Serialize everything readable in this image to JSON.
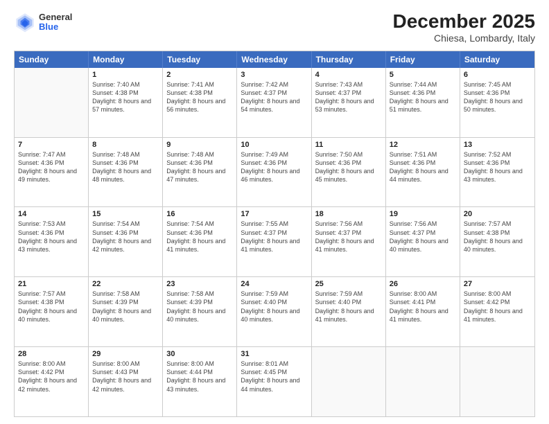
{
  "logo": {
    "general": "General",
    "blue": "Blue"
  },
  "title": "December 2025",
  "subtitle": "Chiesa, Lombardy, Italy",
  "days": [
    "Sunday",
    "Monday",
    "Tuesday",
    "Wednesday",
    "Thursday",
    "Friday",
    "Saturday"
  ],
  "weeks": [
    [
      {
        "day": "",
        "empty": true
      },
      {
        "day": "1",
        "sunrise": "7:40 AM",
        "sunset": "4:38 PM",
        "daylight": "8 hours and 57 minutes."
      },
      {
        "day": "2",
        "sunrise": "7:41 AM",
        "sunset": "4:38 PM",
        "daylight": "8 hours and 56 minutes."
      },
      {
        "day": "3",
        "sunrise": "7:42 AM",
        "sunset": "4:37 PM",
        "daylight": "8 hours and 54 minutes."
      },
      {
        "day": "4",
        "sunrise": "7:43 AM",
        "sunset": "4:37 PM",
        "daylight": "8 hours and 53 minutes."
      },
      {
        "day": "5",
        "sunrise": "7:44 AM",
        "sunset": "4:36 PM",
        "daylight": "8 hours and 51 minutes."
      },
      {
        "day": "6",
        "sunrise": "7:45 AM",
        "sunset": "4:36 PM",
        "daylight": "8 hours and 50 minutes."
      }
    ],
    [
      {
        "day": "7",
        "sunrise": "7:47 AM",
        "sunset": "4:36 PM",
        "daylight": "8 hours and 49 minutes."
      },
      {
        "day": "8",
        "sunrise": "7:48 AM",
        "sunset": "4:36 PM",
        "daylight": "8 hours and 48 minutes."
      },
      {
        "day": "9",
        "sunrise": "7:48 AM",
        "sunset": "4:36 PM",
        "daylight": "8 hours and 47 minutes."
      },
      {
        "day": "10",
        "sunrise": "7:49 AM",
        "sunset": "4:36 PM",
        "daylight": "8 hours and 46 minutes."
      },
      {
        "day": "11",
        "sunrise": "7:50 AM",
        "sunset": "4:36 PM",
        "daylight": "8 hours and 45 minutes."
      },
      {
        "day": "12",
        "sunrise": "7:51 AM",
        "sunset": "4:36 PM",
        "daylight": "8 hours and 44 minutes."
      },
      {
        "day": "13",
        "sunrise": "7:52 AM",
        "sunset": "4:36 PM",
        "daylight": "8 hours and 43 minutes."
      }
    ],
    [
      {
        "day": "14",
        "sunrise": "7:53 AM",
        "sunset": "4:36 PM",
        "daylight": "8 hours and 43 minutes."
      },
      {
        "day": "15",
        "sunrise": "7:54 AM",
        "sunset": "4:36 PM",
        "daylight": "8 hours and 42 minutes."
      },
      {
        "day": "16",
        "sunrise": "7:54 AM",
        "sunset": "4:36 PM",
        "daylight": "8 hours and 41 minutes."
      },
      {
        "day": "17",
        "sunrise": "7:55 AM",
        "sunset": "4:37 PM",
        "daylight": "8 hours and 41 minutes."
      },
      {
        "day": "18",
        "sunrise": "7:56 AM",
        "sunset": "4:37 PM",
        "daylight": "8 hours and 41 minutes."
      },
      {
        "day": "19",
        "sunrise": "7:56 AM",
        "sunset": "4:37 PM",
        "daylight": "8 hours and 40 minutes."
      },
      {
        "day": "20",
        "sunrise": "7:57 AM",
        "sunset": "4:38 PM",
        "daylight": "8 hours and 40 minutes."
      }
    ],
    [
      {
        "day": "21",
        "sunrise": "7:57 AM",
        "sunset": "4:38 PM",
        "daylight": "8 hours and 40 minutes."
      },
      {
        "day": "22",
        "sunrise": "7:58 AM",
        "sunset": "4:39 PM",
        "daylight": "8 hours and 40 minutes."
      },
      {
        "day": "23",
        "sunrise": "7:58 AM",
        "sunset": "4:39 PM",
        "daylight": "8 hours and 40 minutes."
      },
      {
        "day": "24",
        "sunrise": "7:59 AM",
        "sunset": "4:40 PM",
        "daylight": "8 hours and 40 minutes."
      },
      {
        "day": "25",
        "sunrise": "7:59 AM",
        "sunset": "4:40 PM",
        "daylight": "8 hours and 41 minutes."
      },
      {
        "day": "26",
        "sunrise": "8:00 AM",
        "sunset": "4:41 PM",
        "daylight": "8 hours and 41 minutes."
      },
      {
        "day": "27",
        "sunrise": "8:00 AM",
        "sunset": "4:42 PM",
        "daylight": "8 hours and 41 minutes."
      }
    ],
    [
      {
        "day": "28",
        "sunrise": "8:00 AM",
        "sunset": "4:42 PM",
        "daylight": "8 hours and 42 minutes."
      },
      {
        "day": "29",
        "sunrise": "8:00 AM",
        "sunset": "4:43 PM",
        "daylight": "8 hours and 42 minutes."
      },
      {
        "day": "30",
        "sunrise": "8:00 AM",
        "sunset": "4:44 PM",
        "daylight": "8 hours and 43 minutes."
      },
      {
        "day": "31",
        "sunrise": "8:01 AM",
        "sunset": "4:45 PM",
        "daylight": "8 hours and 44 minutes."
      },
      {
        "day": "",
        "empty": true
      },
      {
        "day": "",
        "empty": true
      },
      {
        "day": "",
        "empty": true
      }
    ]
  ]
}
